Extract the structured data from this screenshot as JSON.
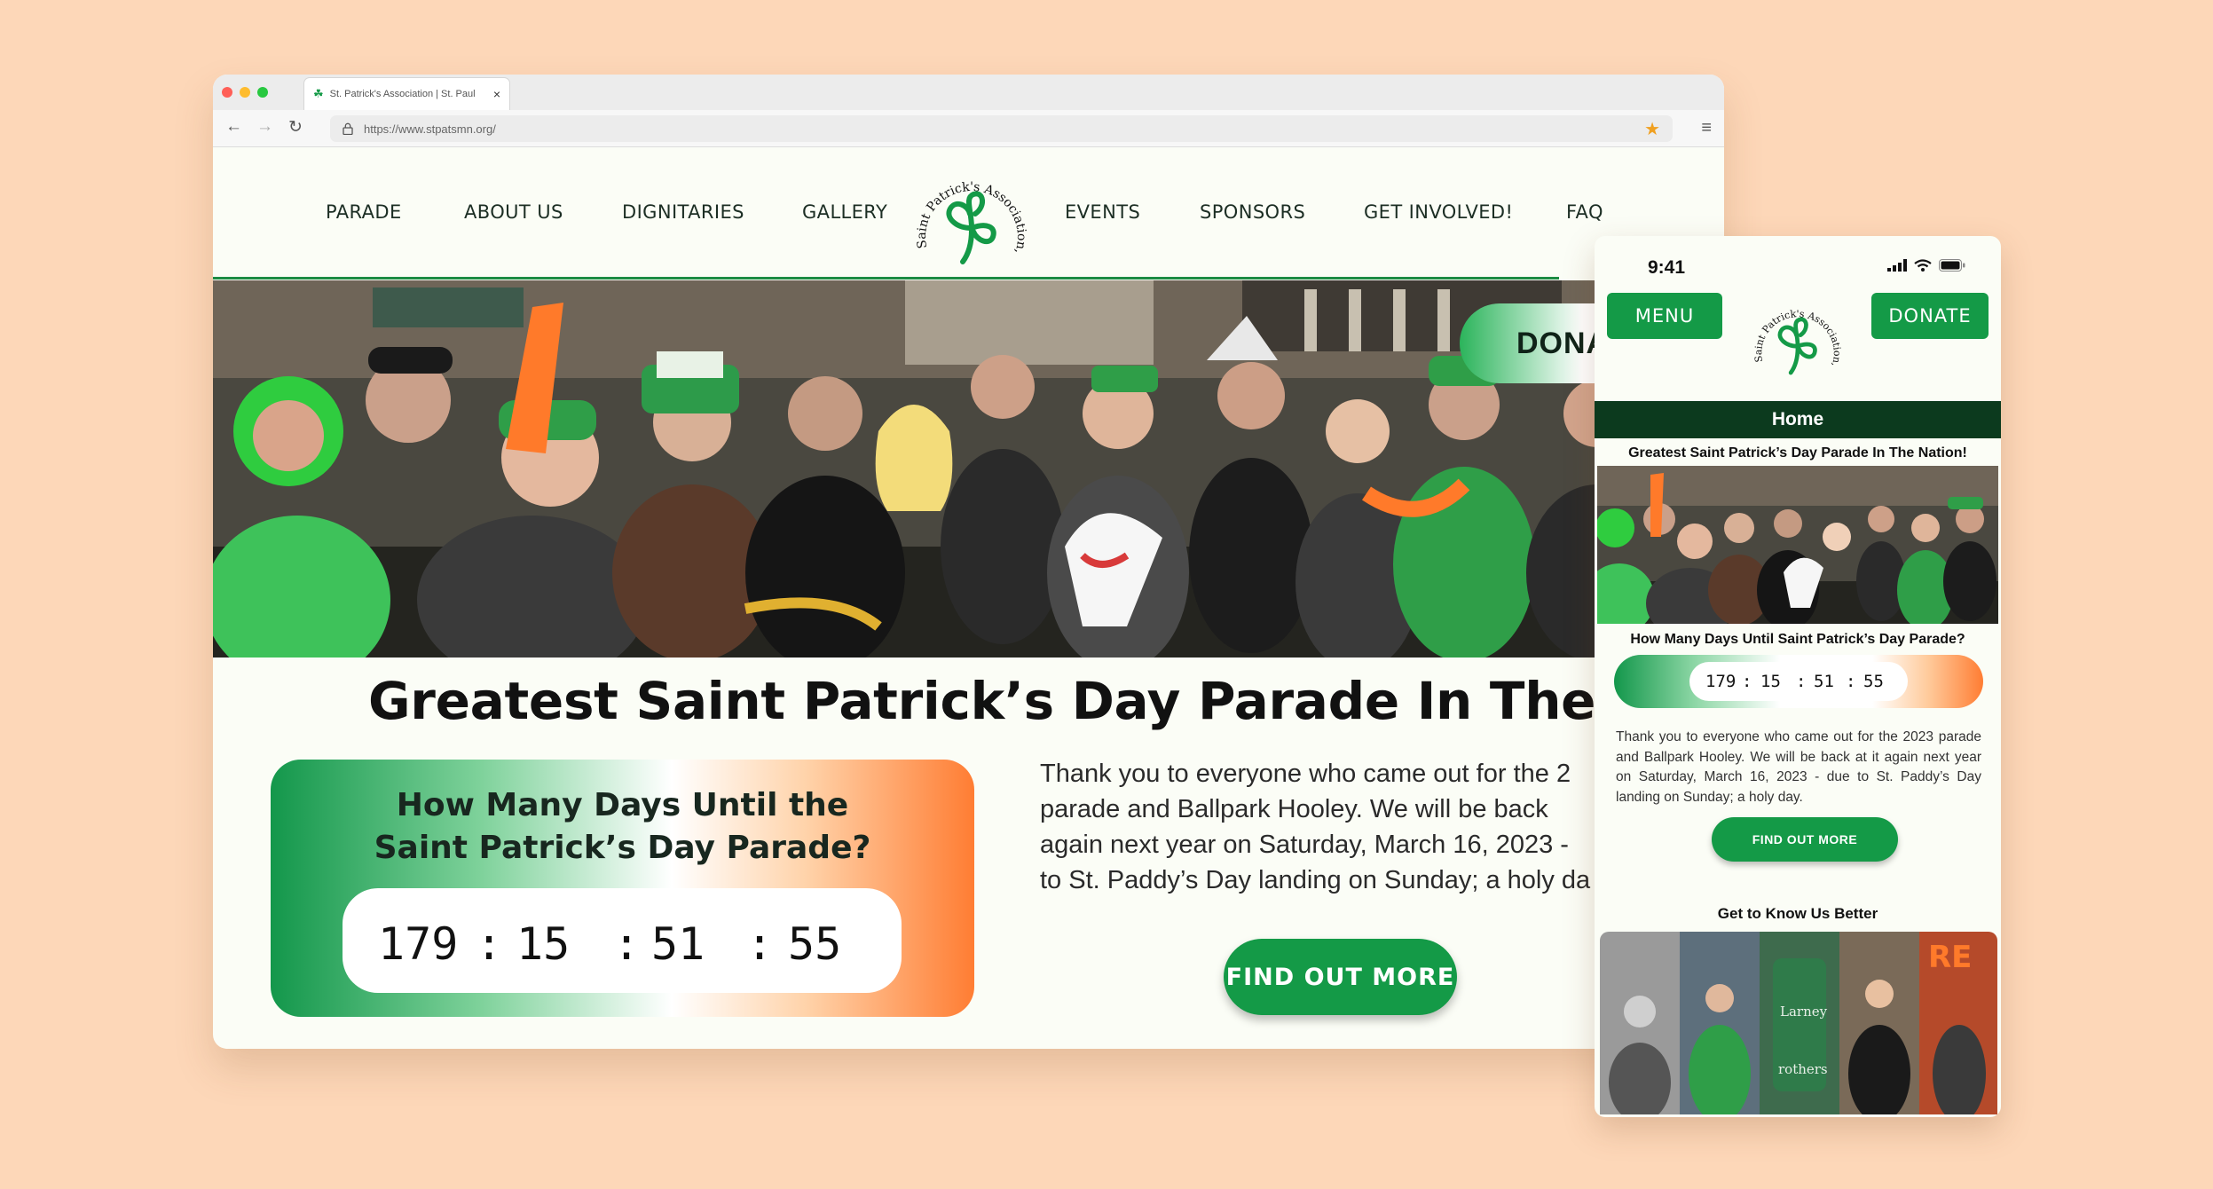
{
  "browser": {
    "tab_title": "St. Patrick's Association | St. Paul",
    "url": "https://www.stpatsmn.org/"
  },
  "nav": {
    "items": [
      "PARADE",
      "ABOUT US",
      "DIGNITARIES",
      "GALLERY",
      "EVENTS",
      "SPONSORS",
      "GET INVOLVED!",
      "FAQ"
    ]
  },
  "logo": {
    "text": "Saint Patrick's Association, Inc"
  },
  "desktop": {
    "donate_label": "DONAT",
    "headline": "Greatest Saint Patrick’s Day Parade In The Nation!",
    "countdown_title": [
      "How Many Days Until the",
      "Saint Patrick’s Day Parade?"
    ],
    "countdown": {
      "days": "179",
      "sep1": ":",
      "hours": "15",
      "sep2": ":",
      "minutes": "51",
      "sep3": ":",
      "seconds": "55"
    },
    "body_lines": [
      "Thank you to everyone who came out for the 2",
      "parade and Ballpark Hooley. We will be back",
      "again next year on Saturday, March 16, 2023 -",
      "to St. Paddy’s Day landing on Sunday; a holy da"
    ],
    "find_label": "FIND OUT MORE"
  },
  "mobile": {
    "time": "9:41",
    "menu_label": "MENU",
    "donate_label": "DONATE",
    "home_label": "Home",
    "subtitle": "Greatest Saint Patrick’s Day Parade In The Nation!",
    "question": "How Many Days Until Saint Patrick’s Day Parade?",
    "countdown": {
      "days": "179",
      "sep1": ":",
      "hours": "15",
      "sep2": ":",
      "minutes": "51",
      "sep3": ":",
      "seconds": "55"
    },
    "body": "Thank you to everyone who came out for the 2023 parade and Ballpark Hooley. We will be back at it again next year on Saturday, March 16, 2023 - due to St. Paddy’s Day landing on Sunday; a holy day.",
    "find_label": "FIND OUT MORE",
    "know_heading": "Get to Know Us Better",
    "gallery_sign_1": "Larney",
    "gallery_sign_2": "rothers",
    "gallery_sign_3": "RE"
  },
  "colors": {
    "green": "#149a47",
    "dark_green": "#0c3a1e",
    "orange": "#ff7d33",
    "background": "#fdd7b8"
  }
}
